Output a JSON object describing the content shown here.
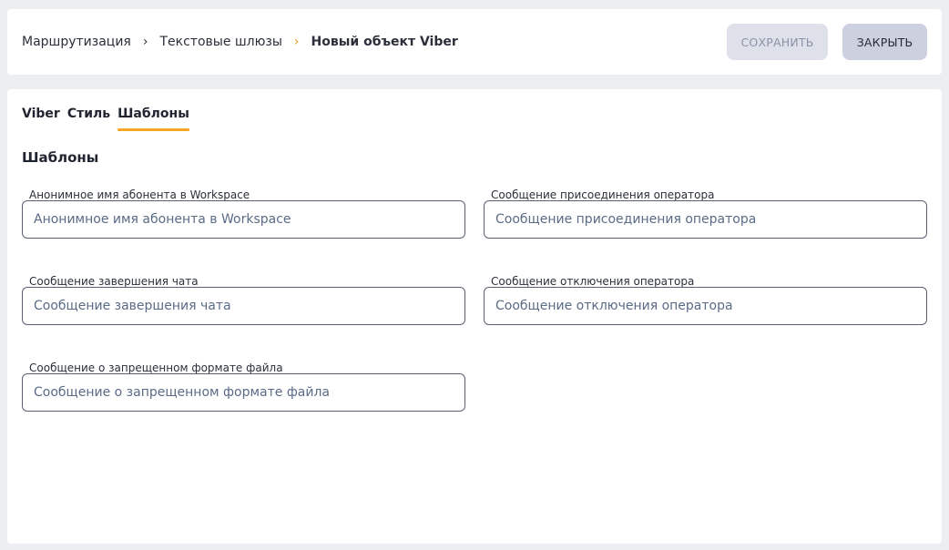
{
  "breadcrumb": {
    "items": [
      "Маршрутизация",
      "Текстовые шлюзы",
      "Новый объект Viber"
    ]
  },
  "toolbar": {
    "save_label": "СОХРАНИТЬ",
    "close_label": "ЗАКРЫТЬ"
  },
  "tabs": [
    {
      "label": "Viber",
      "active": false
    },
    {
      "label": "Стиль",
      "active": false
    },
    {
      "label": "Шаблоны",
      "active": true
    }
  ],
  "section": {
    "title": "Шаблоны"
  },
  "fields": [
    {
      "label": "Анонимное имя абонента в Workspace",
      "placeholder": "Анонимное имя абонента в Workspace",
      "value": ""
    },
    {
      "label": "Сообщение присоединения оператора",
      "placeholder": "Сообщение присоединения оператора",
      "value": ""
    },
    {
      "label": "Сообщение завершения чата",
      "placeholder": "Сообщение завершения чата",
      "value": ""
    },
    {
      "label": "Сообщение отключения оператора",
      "placeholder": "Сообщение отключения оператора",
      "value": ""
    },
    {
      "label": "Сообщение о запрещенном формате файла",
      "placeholder": "Сообщение о запрещенном формате файла",
      "value": ""
    }
  ],
  "colors": {
    "accent": "#f5a623",
    "background": "#eceef2",
    "save_button_bg": "#dfe1ea",
    "close_button_bg": "#cdd0de"
  }
}
